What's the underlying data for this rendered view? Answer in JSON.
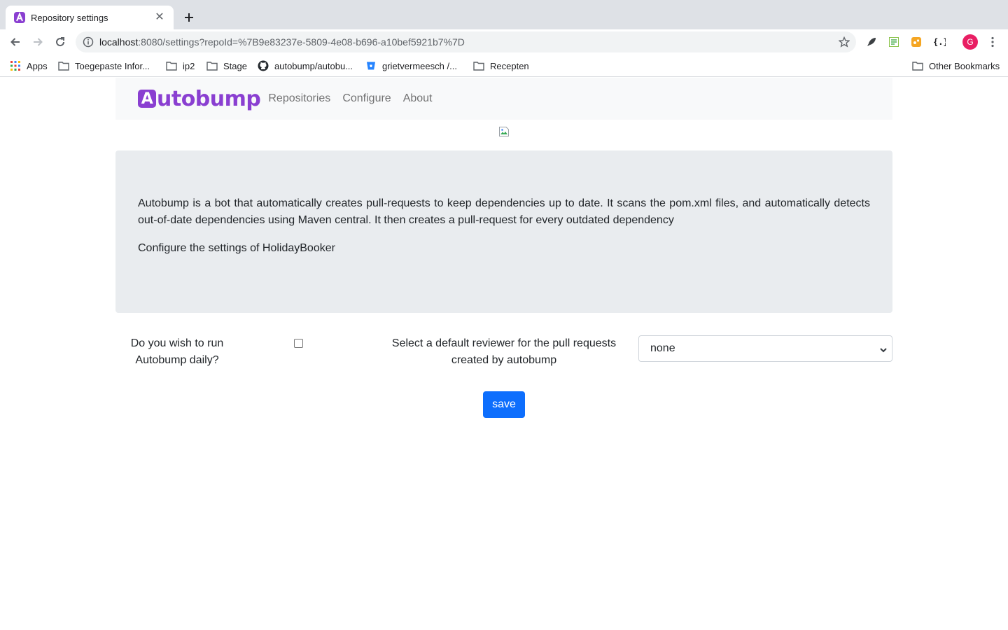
{
  "browser": {
    "tab_title": "Repository settings",
    "url_host": "localhost",
    "url_rest": ":8080/settings?repoId=%7B9e83237e-5809-4e08-b696-a10bef5921b7%7D",
    "avatar_letter": "G",
    "bookmarks": [
      {
        "label": "Apps",
        "icon": "apps-grid-icon"
      },
      {
        "label": "Toegepaste Infor...",
        "icon": "folder-icon"
      },
      {
        "label": "ip2",
        "icon": "folder-icon"
      },
      {
        "label": "Stage",
        "icon": "folder-icon"
      },
      {
        "label": "autobump/autobu...",
        "icon": "github-icon"
      },
      {
        "label": "grietvermeesch /...",
        "icon": "bitbucket-icon"
      },
      {
        "label": "Recepten",
        "icon": "folder-icon"
      }
    ],
    "other_bookmarks": "Other Bookmarks"
  },
  "navbar": {
    "brand_first": "A",
    "brand_rest": "utobump",
    "links": [
      "Repositories",
      "Configure",
      "About"
    ]
  },
  "jumbotron": {
    "description": "Autobump is a bot that automatically creates pull-requests to keep dependencies up to date. It scans the pom.xml files, and automatically detects out-of-date dependencies using Maven central. It then creates a pull-request for every outdated dependency",
    "configure_text": "Configure the settings of HolidayBooker"
  },
  "form": {
    "daily_label": "Do you wish to run Autobump daily?",
    "reviewer_label": "Select a default reviewer for the pull requests created by autobump",
    "reviewer_selected": "none",
    "save_label": "save"
  },
  "colors": {
    "brand": "#8a3fd1",
    "primary_button": "#0d6efd",
    "jumbotron_bg": "#e9ecef",
    "navbar_bg": "#f8f9fa"
  }
}
